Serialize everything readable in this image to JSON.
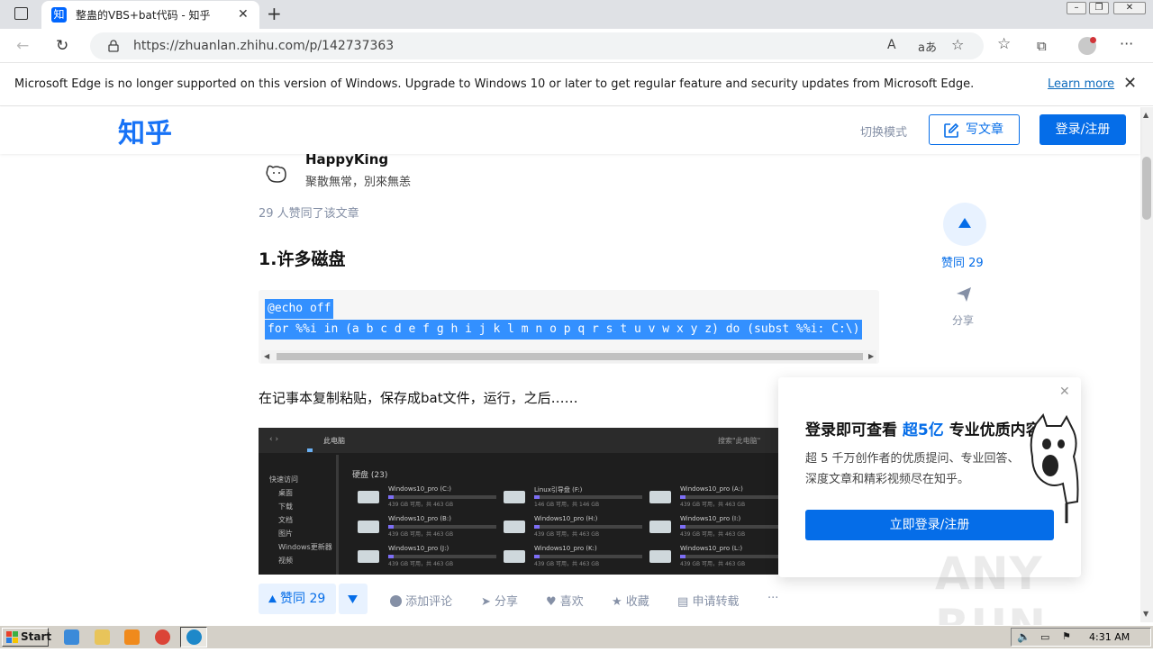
{
  "browser": {
    "tab_title": "整蛊的VBS+bat代码 - 知乎",
    "tab_favicon_text": "知",
    "url": "https://zhuanlan.zhihu.com/p/142737363",
    "reader_label": "A)",
    "translate_label": "aあ"
  },
  "notice": {
    "text": "Microsoft Edge is no longer supported on this version of Windows. Upgrade to Windows 10 or later to get regular feature and security updates from Microsoft Edge.",
    "link": "Learn more"
  },
  "header": {
    "logo": "知乎",
    "switch_mode": "切换模式",
    "write": "写文章",
    "login": "登录/注册"
  },
  "article": {
    "author_name": "HappyKing",
    "author_bio": "聚散無常，別來無恙",
    "vote_summary": "29 人赞同了该文章",
    "heading": "1.许多磁盘",
    "code_lines": [
      "@echo off",
      "for %%i in (a b c d e f g h i j k l m n o p q r s t u v w x y z) do (subst %%i: C:\\)"
    ],
    "paragraph": "在记事本复制粘贴，保存成bat文件，运行，之后……"
  },
  "side": {
    "vote": "赞同 29",
    "share": "分享"
  },
  "popup": {
    "title_pre": "登录即可查看",
    "title_hl": "超5亿",
    "title_post": "专业优质内容",
    "desc": "超 5 千万创作者的优质提问、专业回答、深度文章和精彩视频尽在知乎。",
    "button": "立即登录/注册"
  },
  "actions": {
    "vote": "赞同 29",
    "comment": "添加评论",
    "share": "分享",
    "like": "喜欢",
    "collect": "收藏",
    "repost": "申请转载",
    "more": "···"
  },
  "screenshot": {
    "section": "硬盘 (23)",
    "breadcrumb": "此电脑",
    "search": "搜索\"此电脑\"",
    "nav": [
      "快速访问",
      "桌面",
      "下载",
      "文档",
      "图片",
      "Windows更新器",
      "视频"
    ],
    "drives": [
      {
        "name": "Windows10_pro (C:)",
        "info": "439 GB 可用，共 463 GB"
      },
      {
        "name": "Linux引导盘 (F:)",
        "info": "146 GB 可用，共 146 GB"
      },
      {
        "name": "Windows10_pro (A:)",
        "info": "439 GB 可用，共 463 GB"
      },
      {
        "name": "Windows10_pro (B:)",
        "info": "439 GB 可用，共 463 GB"
      },
      {
        "name": "Windows10_pro (H:)",
        "info": "439 GB 可用，共 463 GB"
      },
      {
        "name": "Windows10_pro (I:)",
        "info": "439 GB 可用，共 463 GB"
      },
      {
        "name": "Windows10_pro (J:)",
        "info": "439 GB 可用，共 463 GB"
      },
      {
        "name": "Windows10_pro (K:)",
        "info": "439 GB 可用，共 463 GB"
      },
      {
        "name": "Windows10_pro (L:)",
        "info": "439 GB 可用，共 463 GB"
      }
    ]
  },
  "watermark": "ANY RUN",
  "taskbar": {
    "start": "Start",
    "clock": "4:31 AM"
  },
  "colors": {
    "zhihu_blue": "#056de8",
    "selection": "#3390ff"
  }
}
